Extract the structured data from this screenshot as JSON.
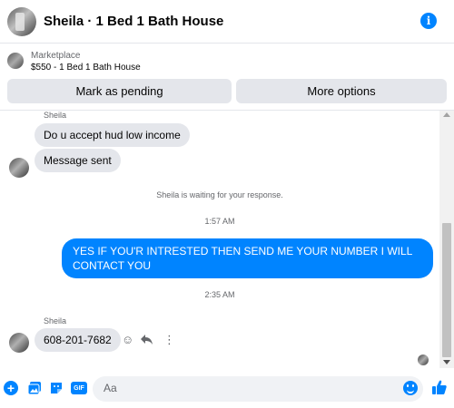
{
  "header": {
    "title": "Sheila · 1 Bed 1 Bath House",
    "info_icon": "info-icon",
    "accent": "#0084ff"
  },
  "banner": {
    "label": "Marketplace",
    "listing": "$550 - 1 Bed 1 Bath House",
    "mark_pending_label": "Mark as pending",
    "more_options_label": "More options"
  },
  "messages": [
    {
      "type": "sender",
      "text": "Sheila"
    },
    {
      "type": "incoming",
      "text": "Do u accept hud low income"
    },
    {
      "type": "incoming",
      "text": "Message sent"
    },
    {
      "type": "system",
      "text": "Sheila is waiting for your response."
    },
    {
      "type": "timestamp",
      "text": "1:57 AM"
    },
    {
      "type": "outgoing",
      "text": "YES IF YOU'R INTRESTED THEN SEND ME YOUR NUMBER I WILL CONTACT YOU"
    },
    {
      "type": "timestamp",
      "text": "2:35 AM"
    },
    {
      "type": "sender",
      "text": "Sheila"
    },
    {
      "type": "incoming",
      "text": "608-201-7682"
    }
  ],
  "composer": {
    "placeholder": "Aa",
    "gif_label": "GIF",
    "plus_label": "+",
    "icons": [
      "plus-icon",
      "photo-icon",
      "sticker-icon",
      "gif-icon",
      "emoji-icon",
      "like-icon"
    ]
  },
  "colors": {
    "outgoing_bubble": "#0084ff",
    "incoming_bubble": "#e4e6eb",
    "muted_text": "#65676b"
  }
}
